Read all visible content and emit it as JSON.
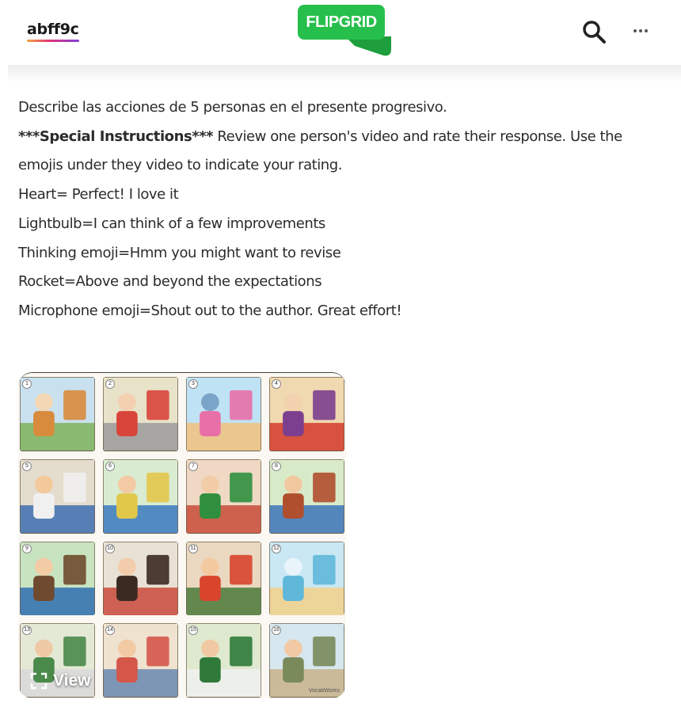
{
  "header": {
    "username": "abff9c",
    "logo_text": "FLIPGRID",
    "brand_colors": {
      "green": "#26bf4b",
      "dark_green": "#1e9e3c"
    },
    "icons": [
      "search-icon",
      "more-icon"
    ]
  },
  "prompt": {
    "line1": "Describe las acciones de 5 personas en el presente progresivo.",
    "special_label": "***Special Instructions***",
    "special_text": " Review one person's video and rate their response. Use the emojis under they video to indicate your rating.",
    "ratings": [
      "Heart= Perfect! I love it",
      "Lightbulb=I can think of a few improvements",
      "Thinking emoji=Hmm you might want to revise",
      "Rocket=Above and beyond the expectations",
      "Microphone emoji=Shout out to the author. Great effort!"
    ]
  },
  "media": {
    "view_label": "View",
    "watermark": "VocabWorks",
    "cells": [
      "1",
      "2",
      "3",
      "4",
      "5",
      "6",
      "7",
      "8",
      "9",
      "10",
      "11",
      "12",
      "13",
      "14",
      "15",
      "16"
    ]
  }
}
